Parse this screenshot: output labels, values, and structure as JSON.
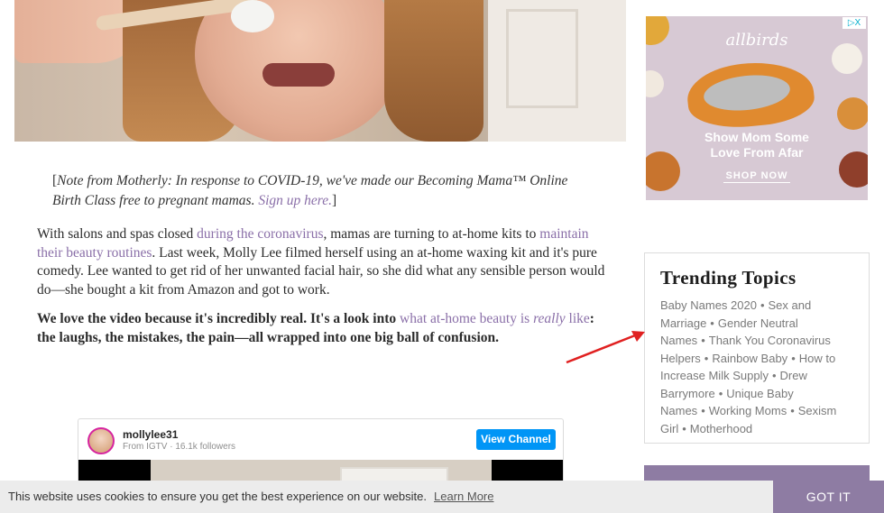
{
  "note": {
    "open": "[",
    "text": "Note from Motherly: In response to COVID-19, we've made our Becoming Mama™ Online Birth Class free to pregnant mamas.",
    "link": "Sign up here.",
    "close": "]"
  },
  "paragraph1": {
    "t1": "With salons and spas closed ",
    "l1": "during the coronavirus",
    "t2": ", mamas are turning to at-home kits to ",
    "l2": "maintain their beauty routines",
    "t3": ". Last week, Molly Lee filmed herself using an at-home waxing kit and it's pure comedy. Lee wanted to get rid of her unwanted facial hair, so she did what any sensible person would do—she bought a kit from Amazon and got to work."
  },
  "paragraph2": {
    "t1": "We love the video because it's incredibly real. It's a look into ",
    "l1a": "what at-home beauty is ",
    "l1b": "really",
    "l1c": " like",
    "t2": ": the laughs, the mistakes, the pain—all wrapped into one big ball of confusion."
  },
  "instagram": {
    "username": "mollylee31",
    "source": "From IGTV · ",
    "followers": "16.1k followers",
    "button": "View Channel"
  },
  "ad": {
    "brand": "allbirds",
    "headline_line1": "Show Mom Some",
    "headline_line2": "Love From Afar",
    "cta": "SHOP NOW",
    "adchoices": "▷X"
  },
  "trending": {
    "title": "Trending Topics",
    "separator": "•",
    "topics": [
      "Baby Names 2020",
      "Sex and Marriage",
      "Gender Neutral Names",
      "Thank You Coronavirus Helpers",
      "Rainbow Baby",
      "How to Increase Milk Supply",
      "Drew Barrymore",
      "Unique Baby Names",
      "Working Moms",
      "Sexism Girl",
      "Motherhood"
    ]
  },
  "cookie": {
    "message": "This website uses cookies to ensure you get the best experience on our website.",
    "learn_more": "Learn More",
    "got_it": "GOT IT"
  },
  "colors": {
    "link": "#8a6fa8",
    "brand_purple": "#8e7ca3",
    "ig_button": "#0095f6",
    "arrow": "#e02020"
  }
}
